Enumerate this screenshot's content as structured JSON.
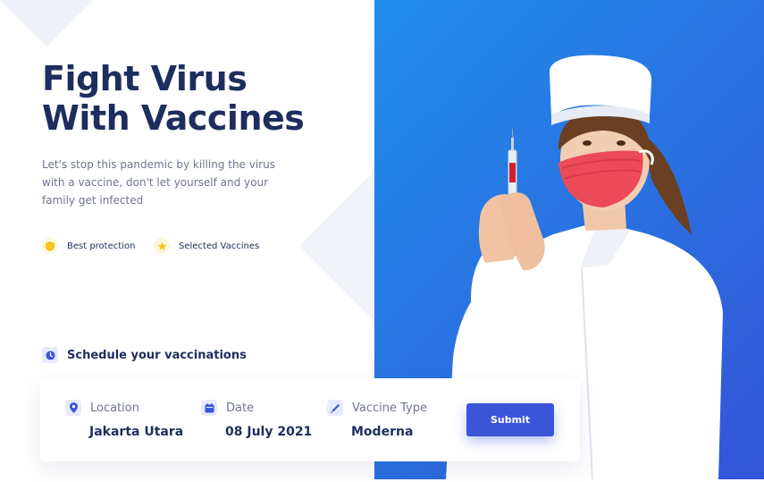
{
  "hero": {
    "title": "Fight Virus With Vaccines",
    "subtitle": "Let's stop this pandemic by killing the virus with a vaccine, don't let yourself and your family get infected"
  },
  "features": [
    {
      "label": "Best protection",
      "icon": "shield-icon"
    },
    {
      "label": "Selected Vaccines",
      "icon": "star-icon"
    }
  ],
  "schedule": {
    "label": "Schedule your vaccinations",
    "icon": "clock-icon"
  },
  "booking": {
    "fields": [
      {
        "label": "Location",
        "value": "Jakarta Utara",
        "icon": "location-pin-icon"
      },
      {
        "label": "Date",
        "value": "08 July 2021",
        "icon": "calendar-icon"
      },
      {
        "label": "Vaccine Type",
        "value": "Moderna",
        "icon": "syringe-icon"
      }
    ],
    "submit_label": "Submit"
  },
  "colors": {
    "primary": "#3b55d9",
    "heading": "#1d2e5e",
    "muted": "#6e7590",
    "accent_yellow": "#f5c518",
    "hero_gradient_start": "#1f8eea",
    "hero_gradient_end": "#3354d8"
  }
}
